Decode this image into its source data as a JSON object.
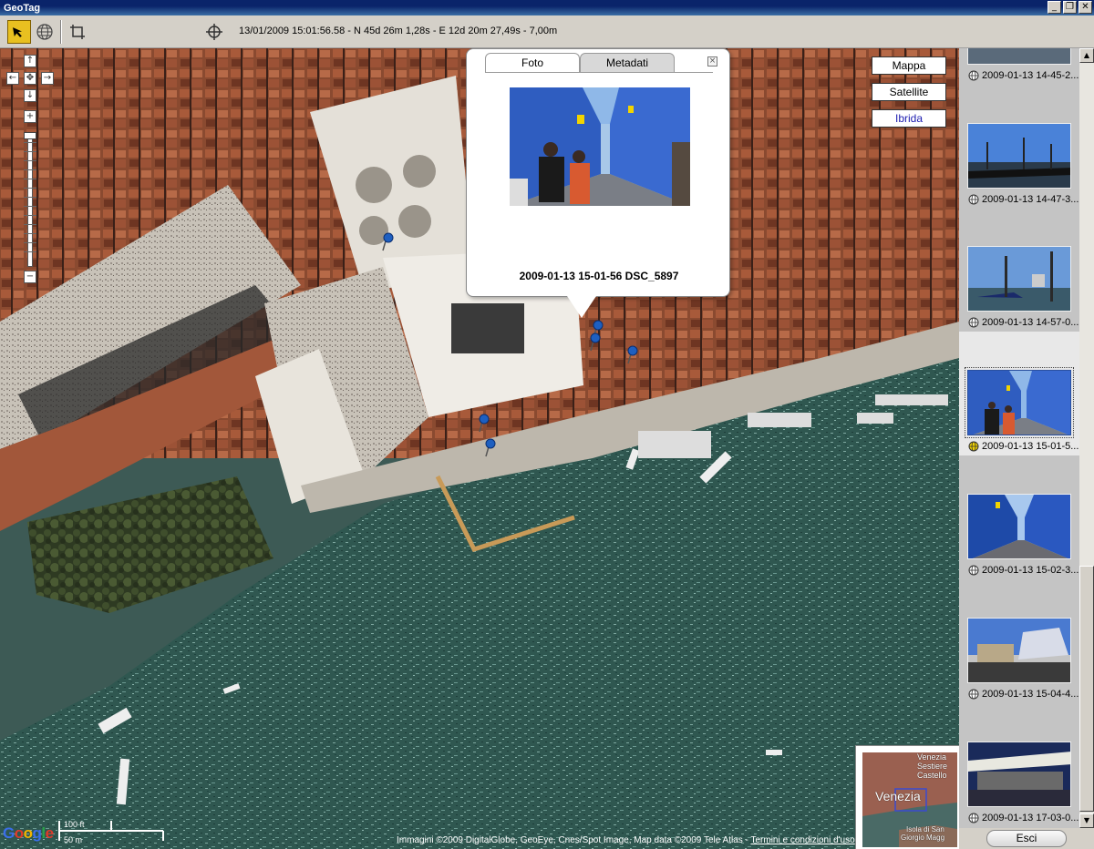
{
  "window": {
    "title": "GeoTag",
    "minimize": "_",
    "restore": "❐",
    "close": "✕"
  },
  "toolbar": {
    "coords": "13/01/2009 15:01:56.58 - N 45d 26m 1,28s - E 12d 20m 27,49s - 7,00m",
    "tools": [
      "select-arrow-icon",
      "globe-icon",
      "crop-icon",
      "crosshair-icon"
    ]
  },
  "map": {
    "nav": {
      "up": "↑",
      "down": "↓",
      "left": "←",
      "right": "→",
      "center": "✥",
      "zoom_in": "+",
      "zoom_out": "−"
    },
    "map_types": {
      "map": "Mappa",
      "satellite": "Satellite",
      "hybrid": "Ibrida",
      "selected": "Ibrida"
    },
    "popup": {
      "tab_photo": "Foto",
      "tab_metadata": "Metadati",
      "close": "×",
      "caption": "2009-01-13 15-01-56 DSC_5897"
    },
    "attribution": "Immagini ©2009 DigitalGlobe, GeoEye, Cnes/Spot Image, Map data ©2009 Tele Atlas - ",
    "terms": "Termini e condizioni d'uso",
    "google_logo": "Google",
    "scale": {
      "feet": "100 ft",
      "meters": "50 m"
    },
    "overview": {
      "city": "Venezia",
      "label1": "Venezia",
      "label2": "Sestiere",
      "label3": "Castello",
      "label4": "Isola di San",
      "label5": "Giorgio Magg"
    }
  },
  "sidebar": {
    "items": [
      {
        "label": "2009-01-13 14-45-2...",
        "selected": false
      },
      {
        "label": "2009-01-13 14-47-3...",
        "selected": false
      },
      {
        "label": "2009-01-13 14-57-0...",
        "selected": false
      },
      {
        "label": "2009-01-13 15-01-5...",
        "selected": true
      },
      {
        "label": "2009-01-13 15-02-3...",
        "selected": false
      },
      {
        "label": "2009-01-13 15-04-4...",
        "selected": false
      },
      {
        "label": "2009-01-13 17-03-0...",
        "selected": false
      }
    ],
    "exit_label": "Esci"
  },
  "colors": {
    "accent": "#0a246a",
    "selected_tool": "#e8c020",
    "map_link": "#1c1cb0"
  }
}
